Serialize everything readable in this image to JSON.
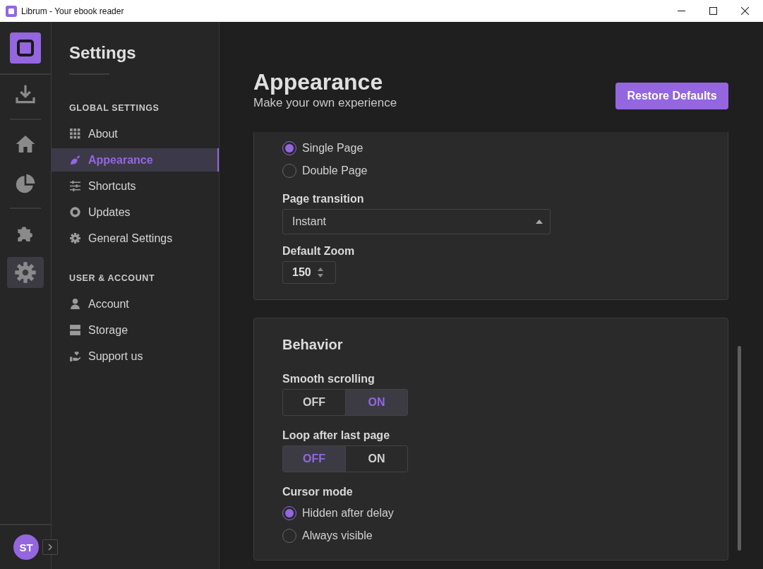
{
  "window": {
    "title": "Librum - Your ebook reader"
  },
  "rail": {
    "items": [
      {
        "selected": false
      },
      {
        "selected": false
      },
      {
        "selected": false
      },
      {
        "selected": false
      },
      {
        "selected": true
      }
    ],
    "avatar": "ST"
  },
  "sidebar": {
    "title": "Settings",
    "groups": [
      {
        "heading": "GLOBAL SETTINGS",
        "items": [
          {
            "label": "About",
            "selected": false
          },
          {
            "label": "Appearance",
            "selected": true
          },
          {
            "label": "Shortcuts",
            "selected": false
          },
          {
            "label": "Updates",
            "selected": false
          },
          {
            "label": "General Settings",
            "selected": false
          }
        ]
      },
      {
        "heading": "USER & ACCOUNT",
        "items": [
          {
            "label": "Account",
            "selected": false
          },
          {
            "label": "Storage",
            "selected": false
          },
          {
            "label": "Support us",
            "selected": false
          }
        ]
      }
    ]
  },
  "main": {
    "title": "Appearance",
    "subtitle": "Make your own experience",
    "button": "Restore Defaults",
    "cards": [
      {
        "settings": [
          {
            "kind": "radio",
            "options": [
              {
                "label": "Single Page",
                "selected": true
              },
              {
                "label": "Double Page",
                "selected": false
              }
            ]
          },
          {
            "kind": "select",
            "label": "Page transition",
            "value": "Instant"
          },
          {
            "kind": "spin",
            "label": "Default Zoom",
            "value": "150"
          }
        ]
      },
      {
        "title": "Behavior",
        "settings": [
          {
            "kind": "toggle",
            "label": "Smooth scrolling",
            "options": [
              {
                "label": "OFF",
                "selected": false
              },
              {
                "label": "ON",
                "selected": true
              }
            ]
          },
          {
            "kind": "toggle",
            "label": "Loop after last page",
            "options": [
              {
                "label": "OFF",
                "selected": true
              },
              {
                "label": "ON",
                "selected": false
              }
            ]
          },
          {
            "kind": "radio",
            "label": "Cursor mode",
            "options": [
              {
                "label": "Hidden after delay",
                "selected": true
              },
              {
                "label": "Always visible",
                "selected": false
              }
            ]
          }
        ]
      }
    ]
  }
}
